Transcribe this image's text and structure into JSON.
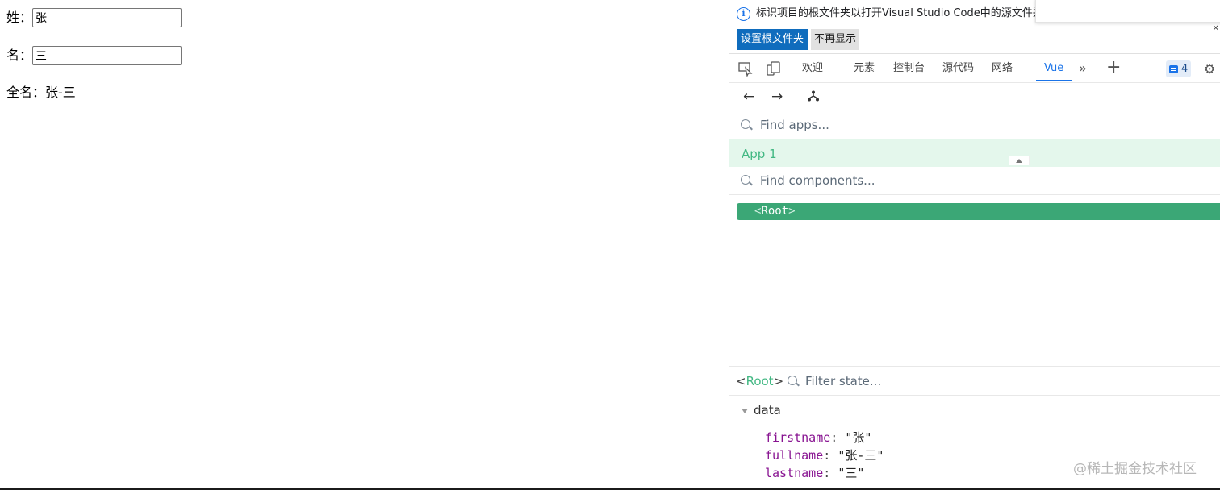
{
  "form": {
    "last_label": "姓：",
    "last_value": "张",
    "first_label": "名：",
    "first_value": "三",
    "full_label": "全名：",
    "full_value": "张-三"
  },
  "infobar": {
    "message": "标识项目的根文件夹以打开Visual Studio Code中的源文件并",
    "primary_button": "设置根文件夹",
    "secondary_button": "不再显示"
  },
  "tabs": {
    "items": [
      "欢迎",
      "元素",
      "控制台",
      "源代码",
      "网络",
      "Vue"
    ],
    "active": "Vue",
    "issues_count": "4"
  },
  "vue": {
    "find_apps_placeholder": "Find apps...",
    "app_name": "App 1",
    "find_components_placeholder": "Find components...",
    "root_open": "<",
    "root_name": "Root",
    "root_close": ">",
    "state_root_name": "Root",
    "filter_placeholder": "Filter state...",
    "data_section": "data",
    "props": [
      {
        "key": "firstname",
        "value": "\"张\""
      },
      {
        "key": "fullname",
        "value": "\"张-三\""
      },
      {
        "key": "lastname",
        "value": "\"三\""
      }
    ]
  },
  "watermark": "@稀土掘金技术社区",
  "colors": {
    "vue_green": "#42b883",
    "root_bg": "#3ba776",
    "accent_blue": "#1a73e8",
    "key_purple": "#881391"
  }
}
